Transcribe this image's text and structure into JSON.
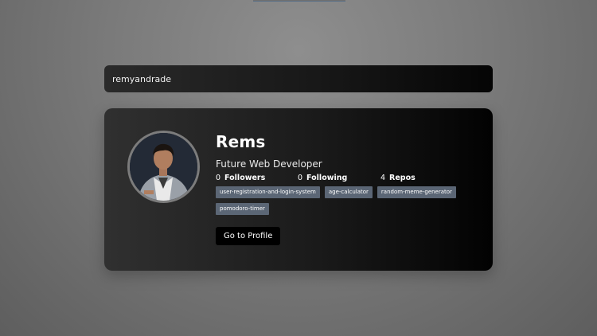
{
  "search": {
    "value": "remyandrade"
  },
  "profile": {
    "name": "Rems",
    "bio": "Future Web Developer",
    "followers_count": "0",
    "followers_label": "Followers",
    "following_count": "0",
    "following_label": "Following",
    "repos_count": "4",
    "repos_label": "Repos",
    "repos": [
      "user-registration-and-login-system",
      "age-calculator",
      "random-meme-generator",
      "pomodoro-timer"
    ],
    "profile_button": "Go to Profile"
  },
  "colors": {
    "card_bg": "#1a1a1a",
    "repo_tag": "#5b6675",
    "button_bg": "#000000"
  }
}
